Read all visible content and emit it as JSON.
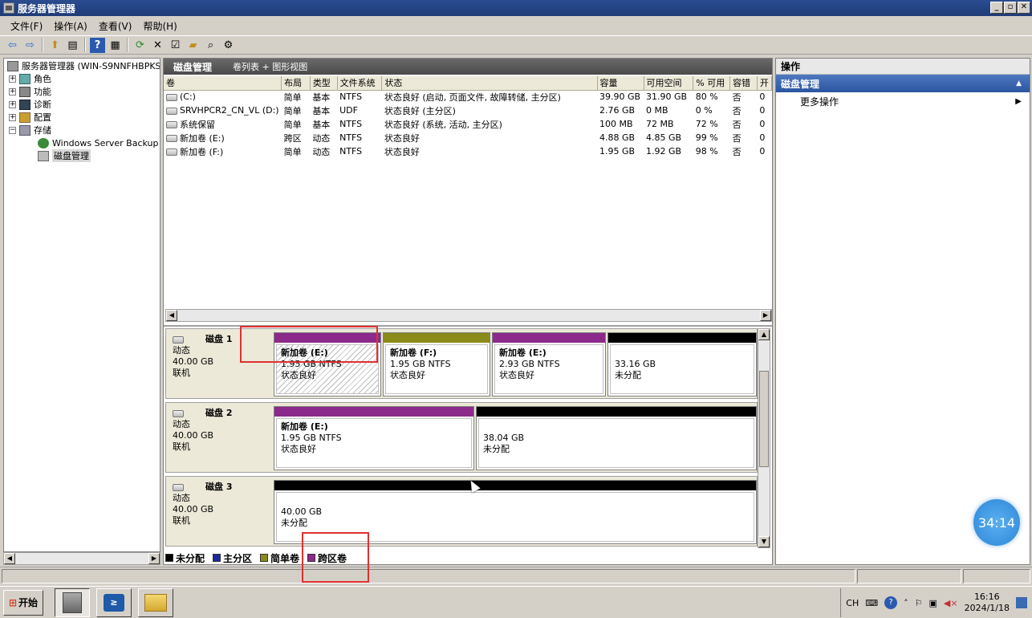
{
  "window": {
    "title": "服务器管理器",
    "btn_min": "_",
    "btn_max": "▫",
    "btn_close": "✕"
  },
  "menu": [
    "文件(F)",
    "操作(A)",
    "查看(V)",
    "帮助(H)"
  ],
  "tree": {
    "root": "服务器管理器 (WIN-S9NNFHBPKS",
    "items": [
      {
        "label": "角色",
        "icon": "roles-icon"
      },
      {
        "label": "功能",
        "icon": "features-icon"
      },
      {
        "label": "诊断",
        "icon": "diagnostics-icon"
      },
      {
        "label": "配置",
        "icon": "config-icon"
      },
      {
        "label": "存储",
        "icon": "storage-icon"
      }
    ],
    "wsb": "Windows Server Backup",
    "disk_mgmt": "磁盘管理"
  },
  "center": {
    "title": "磁盘管理",
    "view": "卷列表 + 图形视图"
  },
  "table": {
    "headers": [
      "卷",
      "布局",
      "类型",
      "文件系统",
      "状态",
      "容量",
      "可用空间",
      "% 可用",
      "容错",
      "开"
    ],
    "rows": [
      [
        "(C:)",
        "简单",
        "基本",
        "NTFS",
        "状态良好 (启动, 页面文件, 故障转储, 主分区)",
        "39.90 GB",
        "31.90 GB",
        "80 %",
        "否",
        "0"
      ],
      [
        "SRVHPCR2_CN_VL (D:)",
        "简单",
        "基本",
        "UDF",
        "状态良好 (主分区)",
        "2.76 GB",
        "0 MB",
        "0 %",
        "否",
        "0"
      ],
      [
        "系统保留",
        "简单",
        "基本",
        "NTFS",
        "状态良好 (系统, 活动, 主分区)",
        "100 MB",
        "72 MB",
        "72 %",
        "否",
        "0"
      ],
      [
        "新加卷 (E:)",
        "跨区",
        "动态",
        "NTFS",
        "状态良好",
        "4.88 GB",
        "4.85 GB",
        "99 %",
        "否",
        "0"
      ],
      [
        "新加卷 (F:)",
        "简单",
        "动态",
        "NTFS",
        "状态良好",
        "1.95 GB",
        "1.92 GB",
        "98 %",
        "否",
        "0"
      ]
    ]
  },
  "disks": [
    {
      "name": "磁盘 1",
      "type": "动态",
      "size": "40.00 GB",
      "state": "联机",
      "parts": [
        {
          "title": "新加卷 (E:)",
          "size": "1.95 GB NTFS",
          "status": "状态良好",
          "color": "#8b2a8b",
          "hatched": true
        },
        {
          "title": "新加卷 (F:)",
          "size": "1.95 GB NTFS",
          "status": "状态良好",
          "color": "#8a8a1a",
          "hatched": false
        },
        {
          "title": "新加卷 (E:)",
          "size": "2.93 GB NTFS",
          "status": "状态良好",
          "color": "#8b2a8b",
          "hatched": false
        },
        {
          "title": "",
          "size": "33.16 GB",
          "status": "未分配",
          "color": "#000000",
          "hatched": false
        }
      ]
    },
    {
      "name": "磁盘 2",
      "type": "动态",
      "size": "40.00 GB",
      "state": "联机",
      "parts": [
        {
          "title": "新加卷 (E:)",
          "size": "1.95 GB NTFS",
          "status": "状态良好",
          "color": "#8b2a8b",
          "hatched": false
        },
        {
          "title": "",
          "size": "38.04 GB",
          "status": "未分配",
          "color": "#000000",
          "hatched": false
        }
      ]
    },
    {
      "name": "磁盘 3",
      "type": "动态",
      "size": "40.00 GB",
      "state": "联机",
      "parts": [
        {
          "title": "",
          "size": "40.00 GB",
          "status": "未分配",
          "color": "#000000",
          "hatched": false
        }
      ]
    }
  ],
  "legend": [
    {
      "label": "未分配",
      "color": "#000000"
    },
    {
      "label": "主分区",
      "color": "#1a2a9a"
    },
    {
      "label": "简单卷",
      "color": "#8a8a1a"
    },
    {
      "label": "跨区卷",
      "color": "#8b2a8b"
    }
  ],
  "actions": {
    "header": "操作",
    "section": "磁盘管理",
    "more": "更多操作"
  },
  "taskbar": {
    "start": "开始",
    "lang": "CH",
    "time": "16:16",
    "date": "2024/1/18"
  },
  "overlay": {
    "timer": "34:14"
  }
}
